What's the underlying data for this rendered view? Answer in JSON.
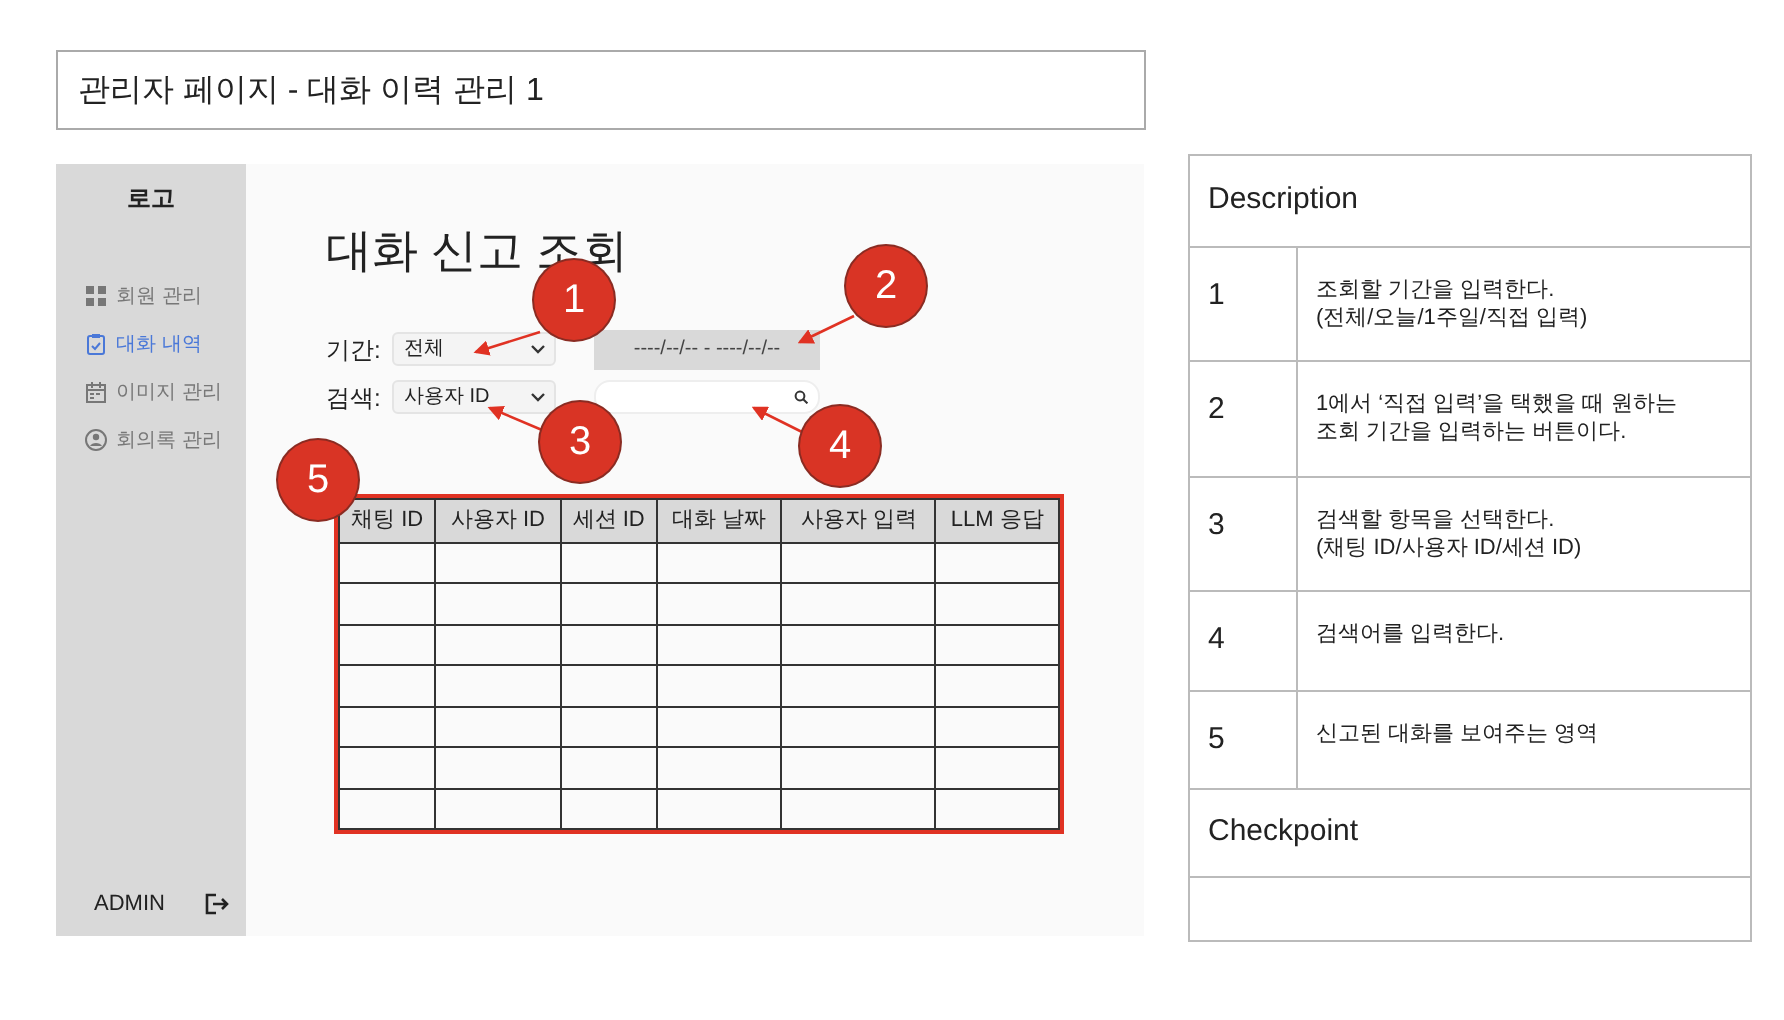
{
  "page_title": "관리자 페이지 - 대화 이력 관리 1",
  "sidebar": {
    "logo": "로고",
    "items": [
      {
        "label": "회원 관리",
        "selected": false
      },
      {
        "label": "대화 내역",
        "selected": true
      },
      {
        "label": "이미지 관리",
        "selected": false
      },
      {
        "label": "회의록 관리",
        "selected": false
      }
    ],
    "user": "ADMIN"
  },
  "main": {
    "heading": "대화 신고 조회",
    "period_label": "기간:",
    "period_select": "전체",
    "date_range": "----/--/-- - ----/--/--",
    "search_label": "검색:",
    "search_select": "사용자 ID"
  },
  "table": {
    "columns": [
      "채팅 ID",
      "사용자 ID",
      "세션 ID",
      "대화 날짜",
      "사용자 입력",
      "LLM 응답"
    ]
  },
  "callouts": [
    {
      "number": "1"
    },
    {
      "number": "2"
    },
    {
      "number": "3"
    },
    {
      "number": "4"
    },
    {
      "number": "5"
    }
  ],
  "description": {
    "title": "Description",
    "rows": [
      {
        "number": "1",
        "text": "조회할 기간을 입력한다.\n(전체/오늘/1주일/직접 입력)"
      },
      {
        "number": "2",
        "text": "1에서 ‘직접 입력’을 택했을 때 원하는\n조회 기간을 입력하는 버튼이다."
      },
      {
        "number": "3",
        "text": "검색할 항목을 선택한다.\n(채팅 ID/사용자 ID/세션 ID)"
      },
      {
        "number": "4",
        "text": "검색어를 입력한다."
      },
      {
        "number": "5",
        "text": "신고된 대화를 보여주는 영역"
      }
    ],
    "checkpoint_title": "Checkpoint"
  }
}
